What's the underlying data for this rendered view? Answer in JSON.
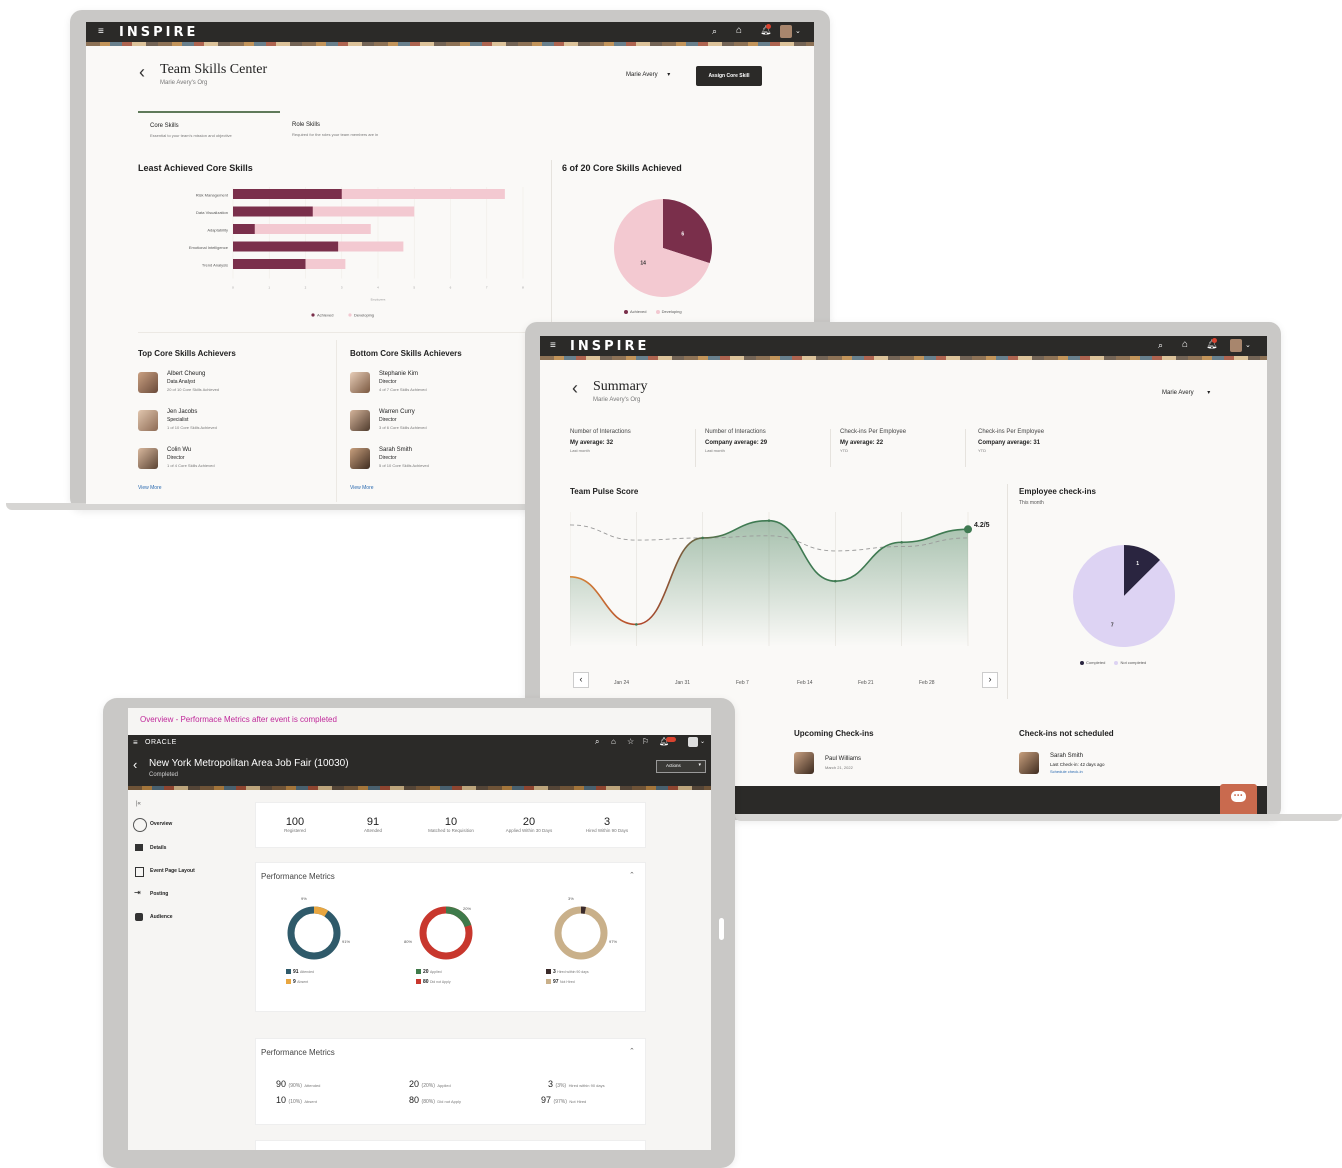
{
  "skills": {
    "brand": "INSPIRE",
    "title": "Team Skills Center",
    "subtitle": "Marie Avery's Org",
    "user_select": "Marie Avery",
    "assign_button": "Assign Core Skill",
    "tabs": [
      {
        "label": "Core Skills",
        "desc": "Essential to your team's mission and objective"
      },
      {
        "label": "Role Skills",
        "desc": "Required for the roles your team members are in"
      }
    ],
    "bar_section_title": "Least Achieved Core Skills",
    "pie_section_title": "6 of 20 Core Skills Achieved",
    "bar_xlabel": "Employees",
    "legend": {
      "achieved": "Achieved",
      "developing": "Developing"
    },
    "top_title": "Top Core Skills Achievers",
    "bottom_title": "Bottom Core Skills Achievers",
    "top_people": [
      {
        "name": "Albert Cheung",
        "role": "Data Analyst",
        "detail": "20 of 10 Core Skills Achieved"
      },
      {
        "name": "Jen Jacobs",
        "role": "Specialist",
        "detail": "1 of 10 Core Skills Achieved"
      },
      {
        "name": "Colin Wu",
        "role": "Director",
        "detail": "1 of 4 Core Skills Achieved"
      }
    ],
    "bottom_people": [
      {
        "name": "Stephanie Kim",
        "role": "Director",
        "detail": "4 of 7 Core Skills Achieved"
      },
      {
        "name": "Warren Curry",
        "role": "Director",
        "detail": "3 of 6 Core Skills Achieved"
      },
      {
        "name": "Sarah Smith",
        "role": "Director",
        "detail": "5 of 10 Core Skills Achieved"
      }
    ],
    "view_more": "View More"
  },
  "summary": {
    "brand": "INSPIRE",
    "title": "Summary",
    "subtitle": "Marie Avery's Org",
    "user_select": "Marie Avery",
    "metrics": [
      {
        "label": "Number of Interactions",
        "value": "My average: 32",
        "period": "Last month"
      },
      {
        "label": "Number of Interactions",
        "value": "Company average: 29",
        "period": "Last month"
      },
      {
        "label": "Check-ins Per Employee",
        "value": "My average: 22",
        "period": "YTD"
      },
      {
        "label": "Check-ins Per Employee",
        "value": "Company average: 31",
        "period": "YTD"
      }
    ],
    "pulse_title": "Team Pulse Score",
    "pulse_value": "4.2/5",
    "checkins_title": "Employee check-ins",
    "checkins_period": "This month",
    "checkins_legend": {
      "completed": "Completed",
      "not_completed": "Not completed"
    },
    "upcoming_title": "Upcoming Check-ins",
    "upcoming_person": {
      "name": "Paul Williams",
      "date": "March 21, 2022"
    },
    "not_scheduled_title": "Check-ins not scheduled",
    "not_scheduled_person": {
      "name": "Sarah Smith",
      "detail": "Last Check-in: 42 days ago",
      "link": "Schedule check-in"
    }
  },
  "event": {
    "breadcrumb": "Overview - Performace Metrics after event is completed",
    "brand": "ORACLE",
    "title": "New York Metropolitan Area Job Fair (10030)",
    "status": "Completed",
    "actions_label": "Actions",
    "nav": [
      {
        "label": "Overview"
      },
      {
        "label": "Details"
      },
      {
        "label": "Event Page Layout"
      },
      {
        "label": "Posting"
      },
      {
        "label": "Audience"
      }
    ],
    "kpis": [
      {
        "value": "100",
        "label": "Registered"
      },
      {
        "value": "91",
        "label": "Attended"
      },
      {
        "value": "10",
        "label": "Matched to Requisition"
      },
      {
        "value": "20",
        "label": "Applied Within 30 Days"
      },
      {
        "value": "3",
        "label": "Hired Within 90 Days"
      }
    ],
    "perf_title": "Performance Metrics",
    "perf_title_2": "Performance Metrics",
    "donuts": [
      {
        "top_pct": "9%",
        "side_pct": "91%",
        "legend": [
          {
            "value": "91",
            "label": "Attended",
            "color": "#2f5a6a"
          },
          {
            "value": "9",
            "label": "Absent",
            "color": "#e8a640"
          }
        ]
      },
      {
        "top_pct": "20%",
        "side_pct": "80%",
        "legend": [
          {
            "value": "20",
            "label": "Applied",
            "color": "#3f7a4a"
          },
          {
            "value": "80",
            "label": "Did not Apply",
            "color": "#c8372d"
          }
        ]
      },
      {
        "top_pct": "3%",
        "side_pct": "97%",
        "legend": [
          {
            "value": "3",
            "label": "Hired within 90 days",
            "color": "#3a2a2a"
          },
          {
            "value": "97",
            "label": "Not Hired",
            "color": "#c9b08a"
          }
        ]
      }
    ],
    "table_rows": [
      [
        {
          "num": "90",
          "pct": "(90%)",
          "label": "Attended"
        },
        {
          "num": "20",
          "pct": "(20%)",
          "label": "Applied"
        },
        {
          "num": "3",
          "pct": "(3%)",
          "label": "Hired within 90 days"
        }
      ],
      [
        {
          "num": "10",
          "pct": "(10%)",
          "label": "Absent"
        },
        {
          "num": "80",
          "pct": "(80%)",
          "label": "Did not Apply"
        },
        {
          "num": "97",
          "pct": "(97%)",
          "label": "Not Hired"
        }
      ]
    ]
  },
  "chart_data": [
    {
      "type": "bar",
      "categories": [
        "Risk Management",
        "Data Visualization",
        "Adaptability",
        "Emotional Intelligence",
        "Trend Analysis"
      ],
      "series": [
        {
          "name": "Achieved",
          "values": [
            3,
            2.2,
            0.6,
            2.9,
            2
          ]
        },
        {
          "name": "Developing",
          "values": [
            7.5,
            5,
            3.8,
            4.7,
            3.1
          ]
        }
      ],
      "xlim": [
        0,
        8
      ]
    },
    {
      "type": "pie",
      "labels": [
        "Achieved",
        "Developing"
      ],
      "values": [
        6,
        14
      ],
      "colors": [
        "#7a2f4b",
        "#f3c9d1"
      ]
    },
    {
      "type": "line",
      "x": [
        "Jan 24",
        "Jan 31",
        "Feb 7",
        "Feb 14",
        "Feb 21",
        "Feb 28"
      ],
      "series": [
        {
          "name": "Team",
          "values": [
            3.1,
            2.0,
            4.0,
            4.4,
            3.0,
            3.9,
            4.2
          ]
        },
        {
          "name": "Company",
          "values": [
            4.3,
            3.95,
            4.0,
            4.05,
            3.7,
            3.8,
            4.0
          ]
        }
      ],
      "ylim": [
        1.5,
        4.6
      ]
    },
    {
      "type": "pie",
      "labels": [
        "Completed",
        "Not completed"
      ],
      "values": [
        1,
        7
      ],
      "colors": [
        "#2a2540",
        "#ddd3f3"
      ]
    }
  ]
}
